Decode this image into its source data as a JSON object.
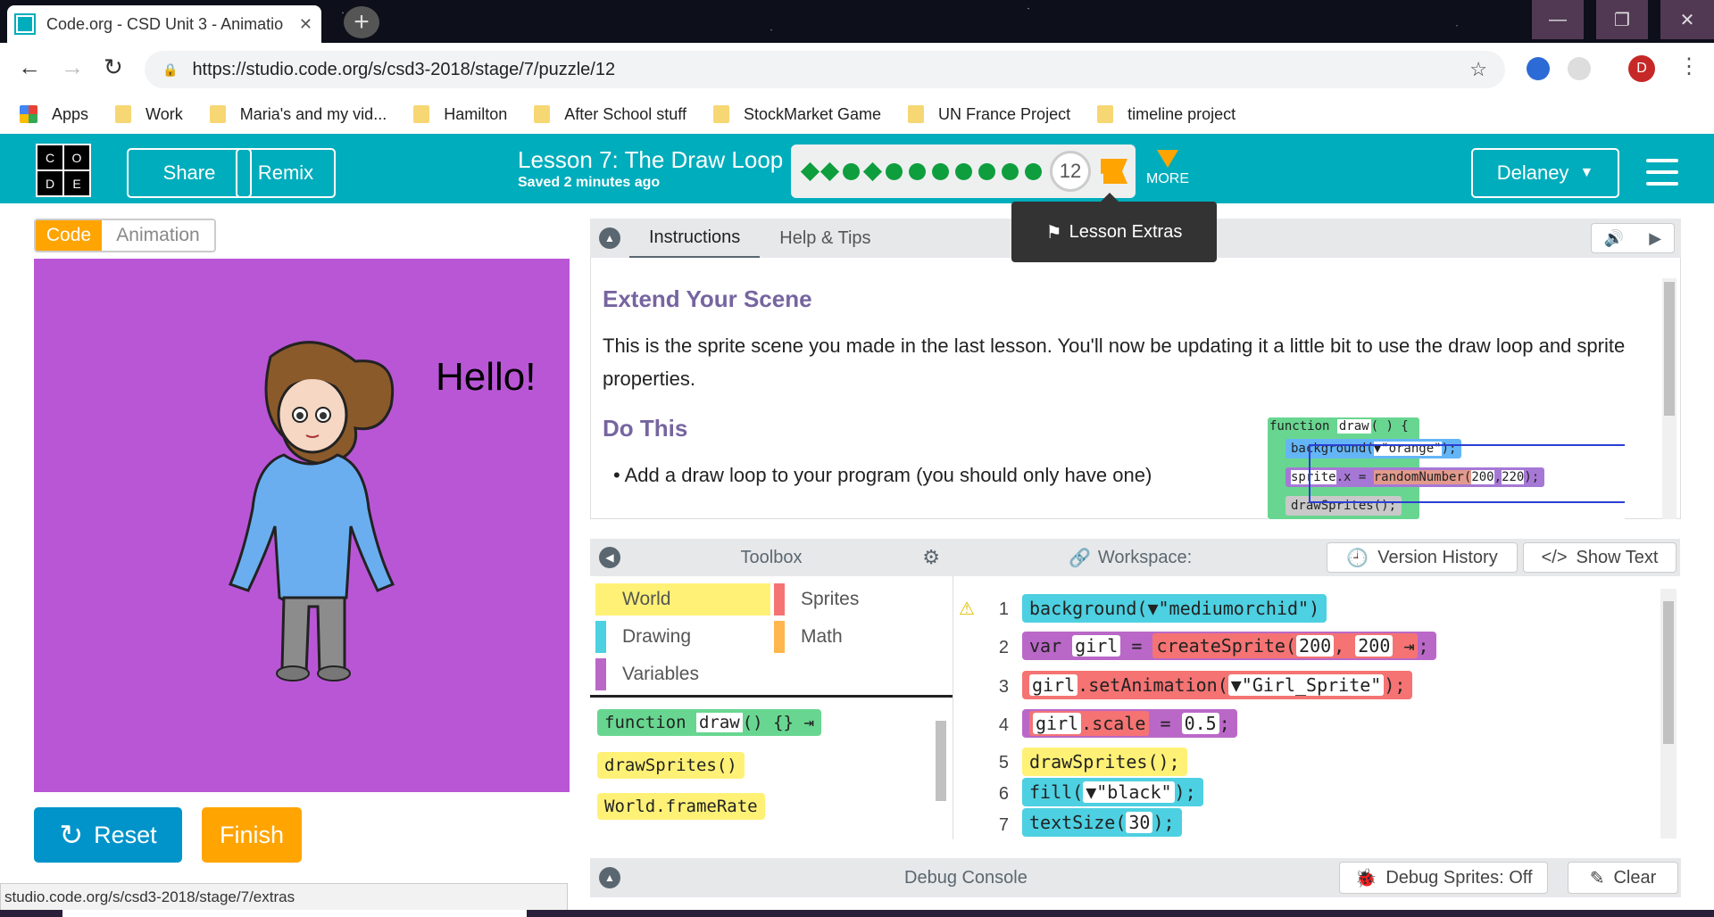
{
  "browser": {
    "tab_title": "Code.org - CSD Unit 3 - Animatio",
    "url": "https://studio.code.org/s/csd3-2018/stage/7/puzzle/12",
    "bookmarks": [
      "Apps",
      "Work",
      "Maria's and my vid...",
      "Hamilton",
      "After School stuff",
      "StockMarket Game",
      "UN France Project",
      "timeline project"
    ],
    "profile_initial": "D"
  },
  "header": {
    "logo": [
      "C",
      "O",
      "D",
      "E"
    ],
    "share": "Share",
    "remix": "Remix",
    "lesson_title": "Lesson 7: The Draw Loop",
    "saved": "Saved 2 minutes ago",
    "current_level": "12",
    "more": "MORE",
    "user": "Delaney",
    "popup": "Lesson Extras"
  },
  "left": {
    "toggle_code": "Code",
    "toggle_animation": "Animation",
    "stage_text": "Hello!",
    "reset": "Reset",
    "finish": "Finish"
  },
  "instructions": {
    "tab_instructions": "Instructions",
    "tab_help": "Help & Tips",
    "heading1": "Extend Your Scene",
    "paragraph": "This is the sprite scene you made in the last lesson. You'll now be updating it a little bit to use the draw loop and sprite properties.",
    "heading2": "Do This",
    "bullet": "Add a draw loop to your program (you should only have one)",
    "img_code": {
      "l1a": "function",
      "l1b": "draw",
      "l1c": "( ) {",
      "l2a": "background(",
      "l2b": "▼\"orange\"",
      "l2c": ");",
      "l3a": "sprite",
      "l3b": ".x",
      "l3c": "=",
      "l3d": "randomNumber(",
      "l3e": "200",
      "l3f": "220",
      "l3g": ");",
      "l4": "drawSprites();"
    }
  },
  "toolbox": {
    "title": "Toolbox",
    "categories": [
      "World",
      "Sprites",
      "Drawing",
      "Math",
      "Variables"
    ],
    "blocks": [
      "function",
      "draw",
      "()  {}",
      "drawSprites()",
      "World.frameRate"
    ]
  },
  "workspace": {
    "title": "Workspace:",
    "version_history": "Version History",
    "show_text": "Show Text",
    "lines": [
      {
        "n": "1",
        "t": "background(▼\"mediumorchid\")"
      },
      {
        "n": "2",
        "a": "var",
        "b": "girl",
        "c": "=",
        "d": "createSprite(",
        "e": "200",
        "f": "200",
        "g": ";"
      },
      {
        "n": "3",
        "a": "girl",
        ".b": "",
        "b": ".setAnimation(",
        "c": "▼\"Girl_Sprite\"",
        "d": ");"
      },
      {
        "n": "4",
        "a": "girl",
        "b": ".scale",
        "c": "=",
        "d": "0.5",
        "e": ";"
      },
      {
        "n": "5",
        "t": "drawSprites();"
      },
      {
        "n": "6",
        "a": "fill(",
        "b": "▼\"black\"",
        "c": ");"
      },
      {
        "n": "7",
        "a": "textSize(",
        "b": "30",
        "c": ");"
      }
    ]
  },
  "debug": {
    "title": "Debug Console",
    "sprites": "Debug Sprites: Off",
    "clear": "Clear"
  },
  "status_url": "studio.code.org/s/csd3-2018/stage/7/extras",
  "colors": {
    "teal": "#00adbc",
    "orange": "#ffa400",
    "stage": "#b956d6",
    "green": "#0e9e3e"
  }
}
